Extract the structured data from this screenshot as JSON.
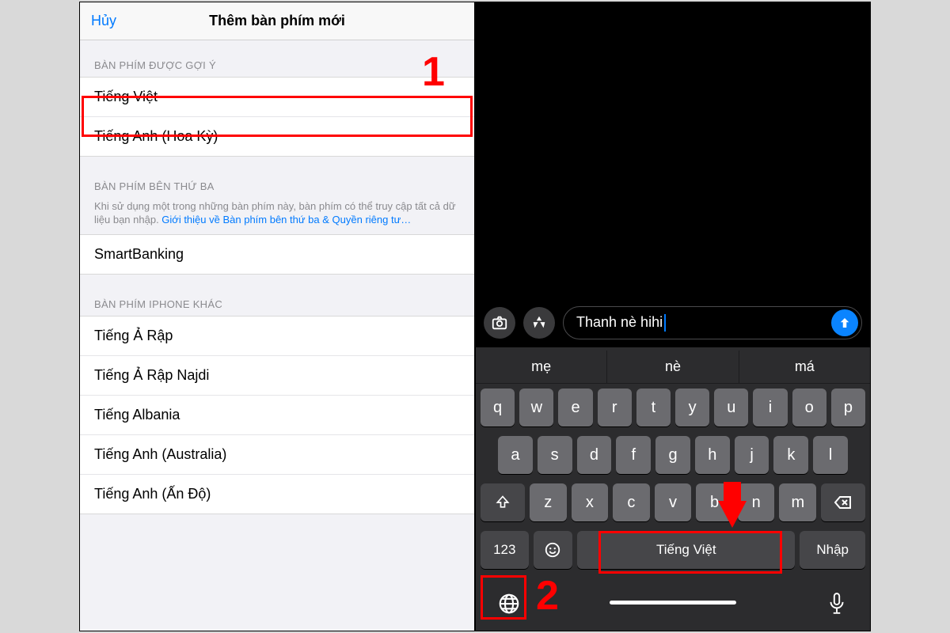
{
  "colors": {
    "accent_blue": "#007aff",
    "send_blue": "#0a84ff",
    "red": "#ff0000"
  },
  "steps": {
    "one": "1",
    "two": "2"
  },
  "left": {
    "cancel": "Hủy",
    "title": "Thêm bàn phím mới",
    "suggested_header": "BÀN PHÍM ĐƯỢC GỢI Ý",
    "suggested": [
      "Tiếng Việt",
      "Tiếng Anh (Hoa Kỳ)"
    ],
    "thirdparty_header": "BÀN PHÍM BÊN THỨ BA",
    "thirdparty_desc": "Khi sử dụng một trong những bàn phím này, bàn phím có thể truy cập tất cả dữ liệu bạn nhập. ",
    "thirdparty_link": "Giới thiệu về Bàn phím bên thứ ba & Quyền riêng tư…",
    "thirdparty": [
      "SmartBanking"
    ],
    "other_header": "BÀN PHÍM IPHONE KHÁC",
    "other": [
      "Tiếng Ả Rập",
      "Tiếng Ả Rập Najdi",
      "Tiếng Albania",
      "Tiếng Anh (Australia)",
      "Tiếng Anh (Ấn Độ)"
    ]
  },
  "right": {
    "input_text": "Thanh nè hihi",
    "suggestions": [
      "mẹ",
      "nè",
      "má"
    ],
    "rows": {
      "r1": [
        "q",
        "w",
        "e",
        "r",
        "t",
        "y",
        "u",
        "i",
        "o",
        "p"
      ],
      "r2": [
        "a",
        "s",
        "d",
        "f",
        "g",
        "h",
        "j",
        "k",
        "l"
      ],
      "r3": [
        "z",
        "x",
        "c",
        "v",
        "b",
        "n",
        "m"
      ]
    },
    "key_123": "123",
    "space_label": "Tiếng Việt",
    "enter_label": "Nhập"
  }
}
